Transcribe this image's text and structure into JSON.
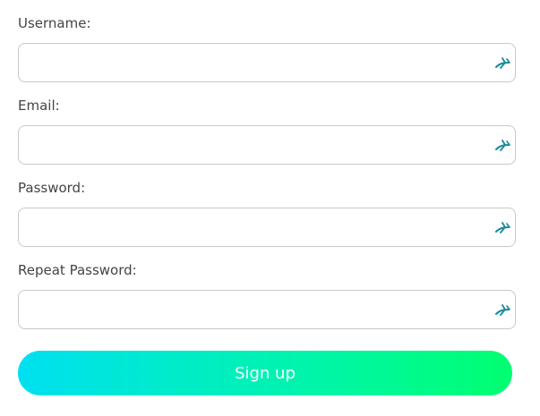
{
  "form": {
    "fields": [
      {
        "label": "Username:",
        "value": "",
        "icon": "password-manager-icon"
      },
      {
        "label": "Email:",
        "value": "",
        "icon": "password-manager-icon"
      },
      {
        "label": "Password:",
        "value": "",
        "icon": "password-manager-icon"
      },
      {
        "label": "Repeat Password:",
        "value": "",
        "icon": "password-manager-icon"
      }
    ],
    "submit_label": "Sign up"
  },
  "colors": {
    "accent_start": "#00e0f0",
    "accent_end": "#00ff70",
    "icon_color": "#1a8a9a",
    "border": "#c9c9c9"
  }
}
